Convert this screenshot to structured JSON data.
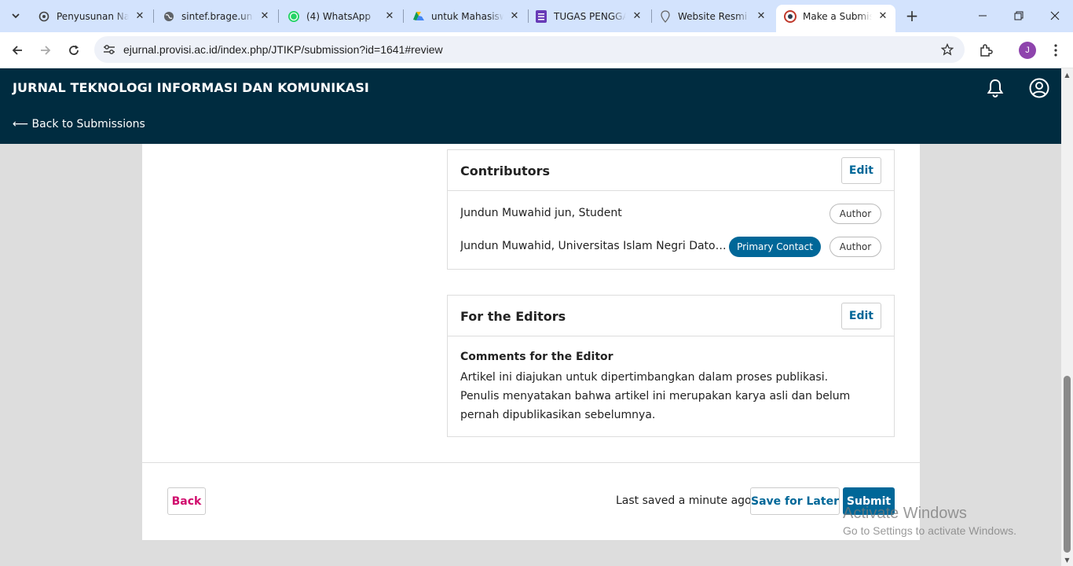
{
  "browser": {
    "tabs": [
      {
        "title": "Penyusunan Nam",
        "icon": "openai-icon",
        "active": false
      },
      {
        "title": "sintef.brage.unit",
        "icon": "globe-icon",
        "active": false
      },
      {
        "title": "(4) WhatsApp",
        "icon": "whatsapp-icon",
        "active": false
      },
      {
        "title": "untuk Mahasisw",
        "icon": "google-drive-icon",
        "active": false
      },
      {
        "title": "TUGAS PENGGA",
        "icon": "forms-icon",
        "active": false
      },
      {
        "title": "Website Resmi P",
        "icon": "map-pin-icon",
        "active": false
      },
      {
        "title": "Make a Submissi",
        "icon": "ojs-icon",
        "active": true
      }
    ],
    "url": "ejurnal.provisi.ac.id/index.php/JTIKP/submission?id=1641#review",
    "profile_initial": "J"
  },
  "header": {
    "journal_title": "JURNAL TEKNOLOGI INFORMASI DAN KOMUNIKASI",
    "back_link": "⟵ Back to Submissions"
  },
  "contributors": {
    "title": "Contributors",
    "edit_label": "Edit",
    "rows": [
      {
        "name": "Jundun Muwahid jun, Student",
        "role": "Author",
        "primary": ""
      },
      {
        "name": "Jundun Muwahid, Universitas Islam Negri Datoka...",
        "role": "Author",
        "primary": "Primary Contact"
      }
    ]
  },
  "editors": {
    "title": "For the Editors",
    "edit_label": "Edit",
    "comments_heading": "Comments for the Editor",
    "comments_text": "Artikel ini diajukan untuk dipertimbangkan dalam proses publikasi. Penulis menyatakan bahwa artikel ini merupakan karya asli dan belum pernah dipublikasikan sebelumnya."
  },
  "footer": {
    "back_label": "Back",
    "last_saved": "Last saved a minute ago",
    "save_later_label": "Save for Later",
    "submit_label": "Submit"
  },
  "watermark": {
    "line1": "Activate Windows",
    "line2": "Go to Settings to activate Windows."
  },
  "colors": {
    "header_bg": "#002c40",
    "primary": "#006798",
    "back_text": "#d00a6c"
  }
}
